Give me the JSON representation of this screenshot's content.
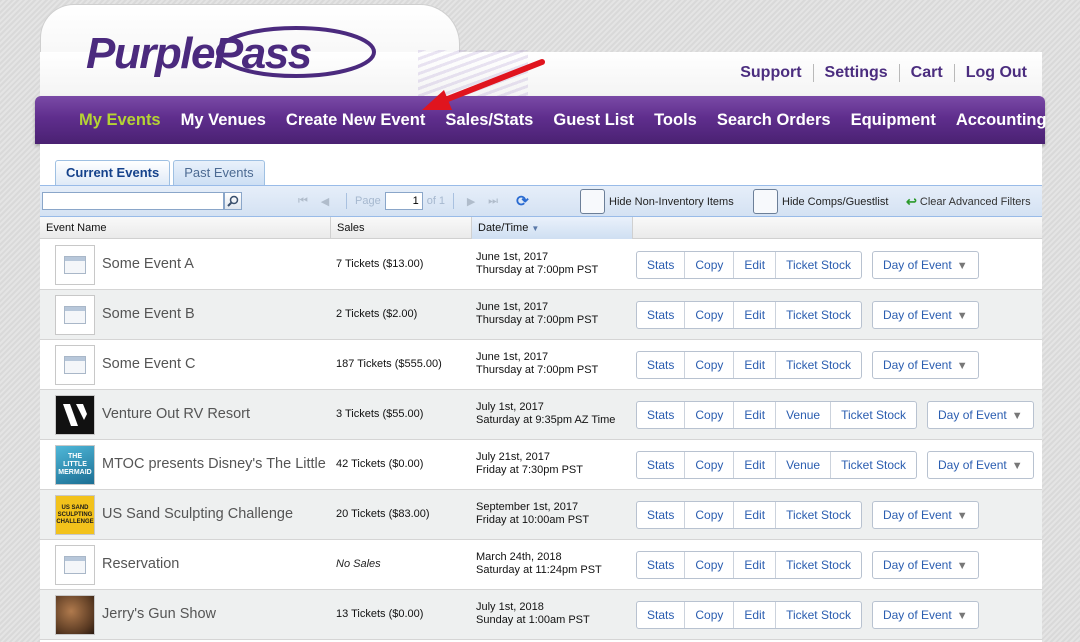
{
  "brand": {
    "logo_text": "PurplePass",
    "logo_color": "#4b2a7e"
  },
  "top_links": [
    "Support",
    "Settings",
    "Cart",
    "Log Out"
  ],
  "nav": [
    {
      "label": "My Events",
      "active": true
    },
    {
      "label": "My Venues"
    },
    {
      "label": "Create New Event"
    },
    {
      "label": "Sales/Stats"
    },
    {
      "label": "Guest List"
    },
    {
      "label": "Tools"
    },
    {
      "label": "Search Orders"
    },
    {
      "label": "Equipment"
    },
    {
      "label": "Accounting"
    }
  ],
  "tabs": {
    "current": "Current Events",
    "past": "Past Events"
  },
  "toolbar": {
    "search_value": "",
    "page_label": "Page",
    "page_value": "1",
    "of_label": "of 1",
    "hide_non_inventory": "Hide Non-Inventory Items",
    "hide_comps": "Hide Comps/Guestlist",
    "clear_filters": "Clear Advanced Filters"
  },
  "columns": {
    "name": "Event Name",
    "sales": "Sales",
    "date": "Date/Time"
  },
  "events": [
    {
      "name": "Some Event A",
      "sales": "7 Tickets ($13.00)",
      "date1": "June 1st, 2017",
      "date2": "Thursday at 7:00pm PST",
      "thumb": "calendar",
      "buttons": [
        "Stats",
        "Copy",
        "Edit",
        "Ticket Stock"
      ]
    },
    {
      "name": "Some Event B",
      "sales": "2 Tickets ($2.00)",
      "date1": "June 1st, 2017",
      "date2": "Thursday at 7:00pm PST",
      "thumb": "calendar",
      "buttons": [
        "Stats",
        "Copy",
        "Edit",
        "Ticket Stock"
      ]
    },
    {
      "name": "Some Event C",
      "sales": "187 Tickets ($555.00)",
      "date1": "June 1st, 2017",
      "date2": "Thursday at 7:00pm PST",
      "thumb": "calendar",
      "buttons": [
        "Stats",
        "Copy",
        "Edit",
        "Ticket Stock"
      ]
    },
    {
      "name": "Venture Out RV Resort",
      "sales": "3 Tickets ($55.00)",
      "date1": "July 1st, 2017",
      "date2": "Saturday at 9:35pm AZ Time",
      "thumb": "venture",
      "buttons": [
        "Stats",
        "Copy",
        "Edit",
        "Venue",
        "Ticket Stock"
      ]
    },
    {
      "name": "MTOC presents Disney's The Little Mermaid",
      "sales": "42 Tickets ($0.00)",
      "date1": "July 21st, 2017",
      "date2": "Friday at 7:30pm PST",
      "thumb": "mermaid",
      "buttons": [
        "Stats",
        "Copy",
        "Edit",
        "Venue",
        "Ticket Stock"
      ]
    },
    {
      "name": "US Sand Sculpting Challenge",
      "sales": "20 Tickets ($83.00)",
      "date1": "September 1st, 2017",
      "date2": "Friday at 10:00am PST",
      "thumb": "sand",
      "buttons": [
        "Stats",
        "Copy",
        "Edit",
        "Ticket Stock"
      ]
    },
    {
      "name": "Reservation",
      "sales": "No Sales",
      "date1": "March 24th, 2018",
      "date2": "Saturday at 11:24pm PST",
      "thumb": "calendar",
      "buttons": [
        "Stats",
        "Copy",
        "Edit",
        "Ticket Stock"
      ]
    },
    {
      "name": "Jerry's Gun Show",
      "sales": "13 Tickets ($0.00)",
      "date1": "July 1st, 2018",
      "date2": "Sunday at 1:00am PST",
      "thumb": "gun",
      "buttons": [
        "Stats",
        "Copy",
        "Edit",
        "Ticket Stock"
      ]
    }
  ],
  "day_of_event_label": "Day of Event",
  "thumb_text": {
    "mermaid": "THE LITTLE MERMAID",
    "sand": "US SAND SCULPTING CHALLENGE"
  },
  "colors": {
    "nav_purple": "#5f2e8d",
    "active_nav": "#b5d334",
    "link_blue": "#2a5db0",
    "annotation_arrow": "#e0141e"
  }
}
